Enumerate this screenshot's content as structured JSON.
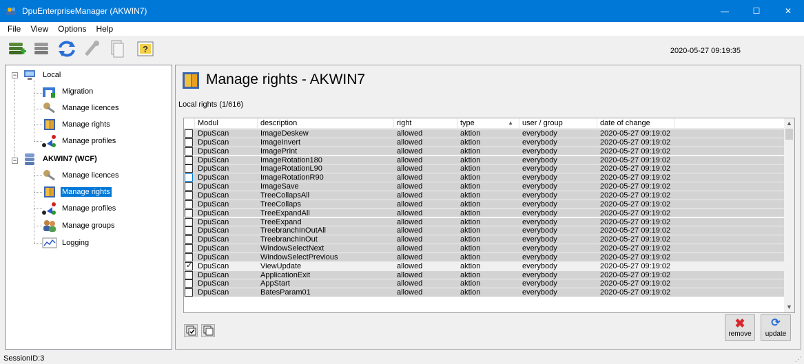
{
  "window": {
    "title": "DpuEnterpriseManager (AKWIN7)",
    "buttons": {
      "minimize": "—",
      "maximize": "☐",
      "close": "✕"
    }
  },
  "menu": [
    "File",
    "View",
    "Options",
    "Help"
  ],
  "toolbar": {
    "datetime": "2020-05-27 09:19:35",
    "icons": [
      "database-add-icon",
      "database-icon",
      "refresh-icon",
      "wrench-icon",
      "document-icon",
      "help-icon"
    ]
  },
  "tree": {
    "local": {
      "label": "Local",
      "children": [
        "Migration",
        "Manage licences",
        "Manage rights",
        "Manage profiles"
      ]
    },
    "server": {
      "label": "AKWIN7 (WCF)",
      "children": [
        "Manage licences",
        "Manage rights",
        "Manage profiles",
        "Manage groups",
        "Logging"
      ],
      "selected": "Manage rights"
    }
  },
  "main": {
    "title": "Manage rights - AKWIN7",
    "subtitle": "Local rights (1/616)",
    "columns": [
      "Modul",
      "description",
      "right",
      "type",
      "user / group",
      "date of change"
    ],
    "sorted_column": "type",
    "rows": [
      {
        "checked": false,
        "modul": "DpuScan",
        "description": "ImageDeskew",
        "right": "allowed",
        "type": "aktion",
        "user": "everybody",
        "date": "2020-05-27 09:19:02"
      },
      {
        "checked": false,
        "modul": "DpuScan",
        "description": "ImageInvert",
        "right": "allowed",
        "type": "aktion",
        "user": "everybody",
        "date": "2020-05-27 09:19:02"
      },
      {
        "checked": false,
        "modul": "DpuScan",
        "description": "ImagePrint",
        "right": "allowed",
        "type": "aktion",
        "user": "everybody",
        "date": "2020-05-27 09:19:02"
      },
      {
        "checked": false,
        "modul": "DpuScan",
        "description": "ImageRotation180",
        "right": "allowed",
        "type": "aktion",
        "user": "everybody",
        "date": "2020-05-27 09:19:02"
      },
      {
        "checked": false,
        "modul": "DpuScan",
        "description": "ImageRotationL90",
        "right": "allowed",
        "type": "aktion",
        "user": "everybody",
        "date": "2020-05-27 09:19:02"
      },
      {
        "checked": false,
        "modul": "DpuScan",
        "description": "ImageRotationR90",
        "right": "allowed",
        "type": "aktion",
        "user": "everybody",
        "date": "2020-05-27 09:19:02",
        "focused": true
      },
      {
        "checked": false,
        "modul": "DpuScan",
        "description": "ImageSave",
        "right": "allowed",
        "type": "aktion",
        "user": "everybody",
        "date": "2020-05-27 09:19:02"
      },
      {
        "checked": false,
        "modul": "DpuScan",
        "description": "TreeCollapsAll",
        "right": "allowed",
        "type": "aktion",
        "user": "everybody",
        "date": "2020-05-27 09:19:02"
      },
      {
        "checked": false,
        "modul": "DpuScan",
        "description": "TreeCollaps",
        "right": "allowed",
        "type": "aktion",
        "user": "everybody",
        "date": "2020-05-27 09:19:02"
      },
      {
        "checked": false,
        "modul": "DpuScan",
        "description": "TreeExpandAll",
        "right": "allowed",
        "type": "aktion",
        "user": "everybody",
        "date": "2020-05-27 09:19:02"
      },
      {
        "checked": false,
        "modul": "DpuScan",
        "description": "TreeExpand",
        "right": "allowed",
        "type": "aktion",
        "user": "everybody",
        "date": "2020-05-27 09:19:02"
      },
      {
        "checked": false,
        "modul": "DpuScan",
        "description": "TreebranchInOutAll",
        "right": "allowed",
        "type": "aktion",
        "user": "everybody",
        "date": "2020-05-27 09:19:02"
      },
      {
        "checked": false,
        "modul": "DpuScan",
        "description": "TreebranchInOut",
        "right": "allowed",
        "type": "aktion",
        "user": "everybody",
        "date": "2020-05-27 09:19:02"
      },
      {
        "checked": false,
        "modul": "DpuScan",
        "description": "WindowSelectNext",
        "right": "allowed",
        "type": "aktion",
        "user": "everybody",
        "date": "2020-05-27 09:19:02"
      },
      {
        "checked": false,
        "modul": "DpuScan",
        "description": "WindowSelectPrevious",
        "right": "allowed",
        "type": "aktion",
        "user": "everybody",
        "date": "2020-05-27 09:19:02"
      },
      {
        "checked": true,
        "modul": "DpuScan",
        "description": "ViewUpdate",
        "right": "allowed",
        "type": "aktion",
        "user": "everybody",
        "date": "2020-05-27 09:19:02"
      },
      {
        "checked": false,
        "modul": "DpuScan",
        "description": "ApplicationExit",
        "right": "allowed",
        "type": "aktion",
        "user": "everybody",
        "date": "2020-05-27 09:19:02"
      },
      {
        "checked": false,
        "modul": "DpuScan",
        "description": "AppStart",
        "right": "allowed",
        "type": "aktion",
        "user": "everybody",
        "date": "2020-05-27 09:19:02"
      },
      {
        "checked": false,
        "modul": "DpuScan",
        "description": "BatesParam01",
        "right": "allowed",
        "type": "aktion",
        "user": "everybody",
        "date": "2020-05-27 09:19:02"
      }
    ],
    "buttons": {
      "remove": "remove",
      "update": "update"
    }
  },
  "status": {
    "session": "SessionID:3"
  },
  "colors": {
    "accent": "#0078d7",
    "row_bg": "#d3d3d3",
    "remove_red": "#d9262c"
  }
}
